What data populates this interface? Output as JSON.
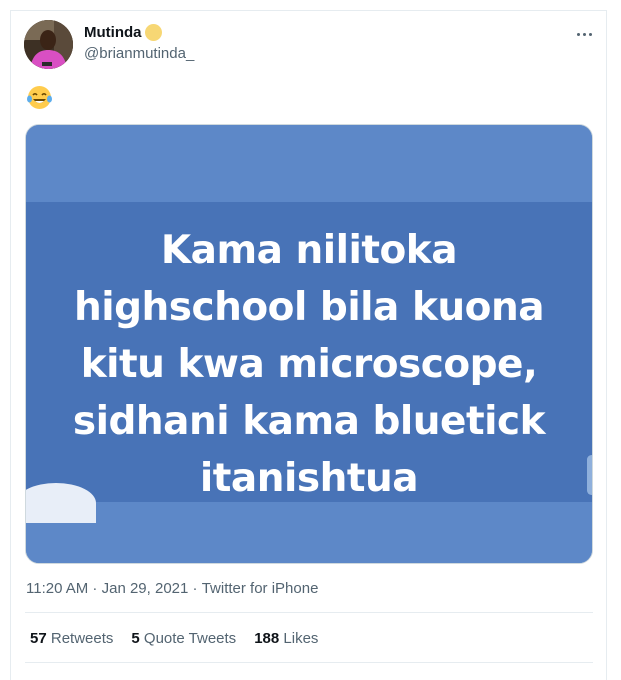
{
  "author": {
    "display_name": "Mutinda",
    "handle": "@brianmutinda_",
    "badge_color": "#f7d774"
  },
  "tweet": {
    "emoji": "face-with-tears-of-joy",
    "media_lines": [
      "Kama nilitoka",
      "highschool bila kuona",
      "kitu kwa microscope,",
      "sidhani kama bluetick",
      "itanishtua"
    ],
    "time": "11:20 AM",
    "separator": " · ",
    "date": "Jan 29, 2021",
    "source": "Twitter for iPhone"
  },
  "stats": {
    "retweets_count": "57",
    "retweets_label": "Retweets",
    "quotes_count": "5",
    "quotes_label": "Quote Tweets",
    "likes_count": "188",
    "likes_label": "Likes"
  },
  "colors": {
    "media_light": "#5d88c8",
    "media_dark": "#4873b7",
    "secondary_text": "#536471"
  }
}
